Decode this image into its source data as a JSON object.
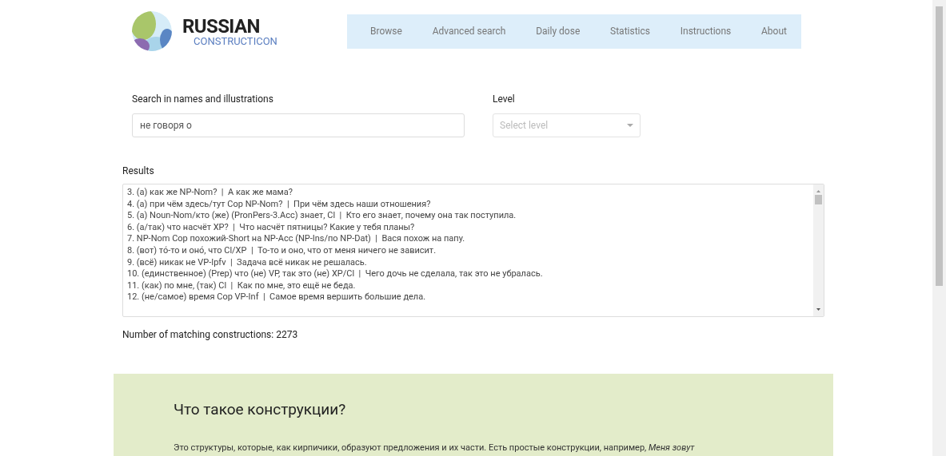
{
  "header": {
    "logo_title": "RUSSIAN",
    "logo_subtitle": "CONSTRUCTICON",
    "nav": [
      {
        "label": "Browse",
        "selected": false
      },
      {
        "label": "Advanced search",
        "selected": false
      },
      {
        "label": "Daily dose",
        "selected": false
      },
      {
        "label": "Statistics",
        "selected": false
      },
      {
        "label": "Instructions",
        "selected": false
      },
      {
        "label": "About",
        "selected": false
      }
    ]
  },
  "search": {
    "label": "Search in names and illustrations",
    "value": "не говоря о"
  },
  "level": {
    "label": "Level",
    "placeholder": "Select level"
  },
  "results": {
    "label": "Results",
    "rows": [
      "3. (а) как же NP-Nom?  |  А как же мама?",
      "4. (а) при чём здесь/тут Cop NP-Nom?  |  При чём здесь наши отношения?",
      "5. (а) Noun-Nom/кто (же) (PronPers-3.Acc) знает, Cl  |  Кто его знает, почему она так поступила.",
      "6. (а/так) что насчёт XP?  |  Что насчёт пятницы? Какие у тебя планы?",
      "7. NP-Nom Cop похожий-Short на NP-Acc (NP-Ins/по NP-Dat)  |  Вася похож на папу.",
      "8. (вот) то́-то и оно́, что Cl/XP  |  То-то и оно, что от меня ничего не зависит.",
      "9. (всё) никак не VP-Ipfv  |  Задача всё никак не решалась.",
      "10. (единственное) (Prep) что (не) VP, так это (не) XP/Cl  |  Чего дочь не сделала, так это не убралась.",
      "11. (как) по мне, (так) Cl  |  Как по мне, это ещё не беда.",
      "12. (не/самое) время Cop VP-Inf  |  Самое время вершить большие дела."
    ],
    "count": "Number of matching constructions: 2273"
  },
  "info": {
    "heading": "Что такое конструкции?",
    "text": "Это структуры, которые, как кирпичики, образуют предложения и их части. Есть простые конструкции, например, *Меня зовут*"
  }
}
